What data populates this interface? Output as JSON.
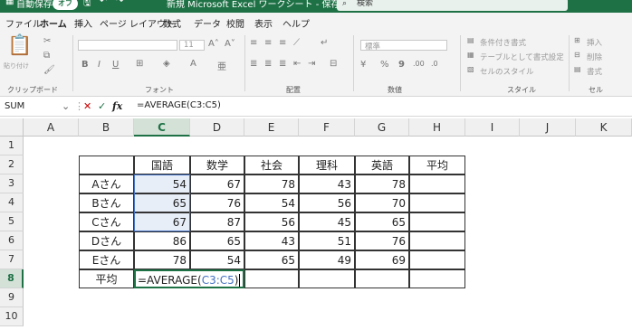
{
  "titlebar": {
    "autosave": "自動保存",
    "toggle": "オフ",
    "filename": "新規 Microsoft Excel ワークシート - 保存済み",
    "search": "検索"
  },
  "menubar": [
    "ファイル",
    "ホーム",
    "挿入",
    "ページ レイアウト",
    "数式",
    "データ",
    "校閲",
    "表示",
    "ヘルプ"
  ],
  "active_menu": "ホーム",
  "ribbon": {
    "clipboard": {
      "label": "クリップボード",
      "paste": "貼り付け"
    },
    "font": {
      "label": "フォント",
      "size": "11",
      "bold": "B",
      "italic": "I",
      "underline": "U"
    },
    "align": {
      "label": "配置"
    },
    "number": {
      "label": "数値",
      "format": "標準",
      "percent": "%",
      "comma": "9"
    },
    "style": {
      "label": "スタイル",
      "cond": "条件付き書式",
      "table": "テーブルとして書式設定",
      "cell": "セルのスタイル"
    },
    "cells": {
      "label": "セル",
      "insert": "挿入",
      "delete": "削除",
      "format": "書式"
    }
  },
  "formulabar": {
    "namebox": "SUM",
    "cancel": "✕",
    "enter": "✓",
    "fx": "fx",
    "formula": "=AVERAGE(C3:C5)"
  },
  "columns": [
    "A",
    "B",
    "C",
    "D",
    "E",
    "F",
    "G",
    "H",
    "I",
    "J",
    "K"
  ],
  "rows": [
    "1",
    "2",
    "3",
    "4",
    "5",
    "6",
    "7",
    "8",
    "9",
    "10"
  ],
  "table": {
    "headers": [
      "国語",
      "数学",
      "社会",
      "理科",
      "英語",
      "平均"
    ],
    "students": [
      {
        "name": "Aさん",
        "scores": [
          54,
          67,
          78,
          43,
          78
        ]
      },
      {
        "name": "Bさん",
        "scores": [
          65,
          76,
          54,
          56,
          70
        ]
      },
      {
        "name": "Cさん",
        "scores": [
          67,
          87,
          56,
          45,
          65
        ]
      },
      {
        "name": "Dさん",
        "scores": [
          86,
          65,
          43,
          51,
          76
        ]
      },
      {
        "name": "Eさん",
        "scores": [
          78,
          54,
          65,
          49,
          69
        ]
      }
    ],
    "avg_label": "平均",
    "active_cell": {
      "prefix": "=AVERAGE(",
      "ref": "C3:C5",
      "suffix": ")"
    }
  },
  "colors": {
    "excel_green": "#1e7145",
    "ref_blue": "#4472c4"
  }
}
